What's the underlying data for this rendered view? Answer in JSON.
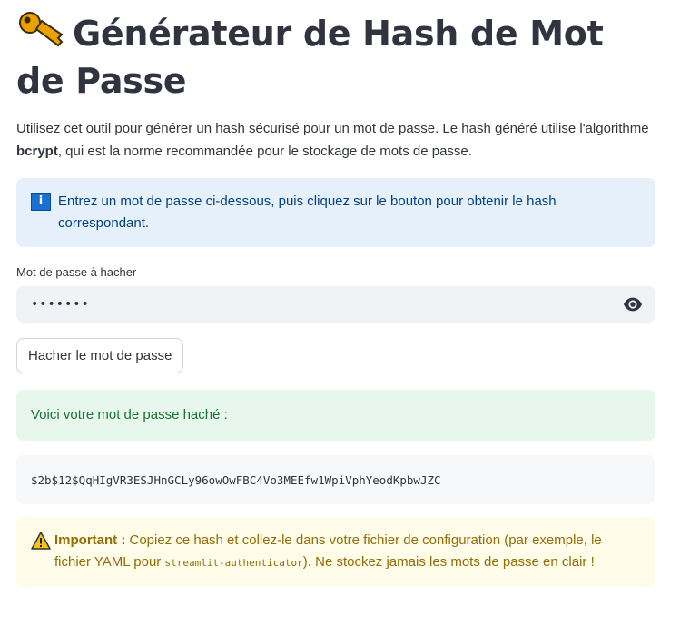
{
  "header": {
    "title": "Générateur de Hash de Mot de Passe",
    "icon": "key-icon"
  },
  "intro": {
    "text_before": "Utilisez cet outil pour générer un hash sécurisé pour un mot de passe. Le hash généré utilise l'algorithme ",
    "bold": "bcrypt",
    "text_after": ", qui est la norme recommandée pour le stockage de mots de passe."
  },
  "info_alert": {
    "icon": "info-icon",
    "text": "Entrez un mot de passe ci-dessous, puis cliquez sur le bouton pour obtenir le hash correspondant."
  },
  "password_field": {
    "label": "Mot de passe à hacher",
    "value": "•••••••",
    "toggle_icon": "eye-icon"
  },
  "hash_button": {
    "label": "Hacher le mot de passe"
  },
  "success_alert": {
    "text": "Voici votre mot de passe haché :"
  },
  "hash_output": {
    "value": "$2b$12$QqHIgVR3ESJHnGCLy96owOwFBC4Vo3MEEfw1WpiVphYeodKpbwJZC"
  },
  "warning_alert": {
    "icon": "warning-icon",
    "bold": "Important :",
    "text_before": " Copiez ce hash et collez-le dans votre fichier de configuration (par exemple, le fichier YAML pour ",
    "code": "streamlit-authenticator",
    "text_after": "). Ne stockez jamais les mots de passe en clair !"
  },
  "colors": {
    "info_bg": "#e6f0fb",
    "success_bg": "#e8f7ee",
    "warning_bg": "#fffde9",
    "text": "#31333f"
  }
}
